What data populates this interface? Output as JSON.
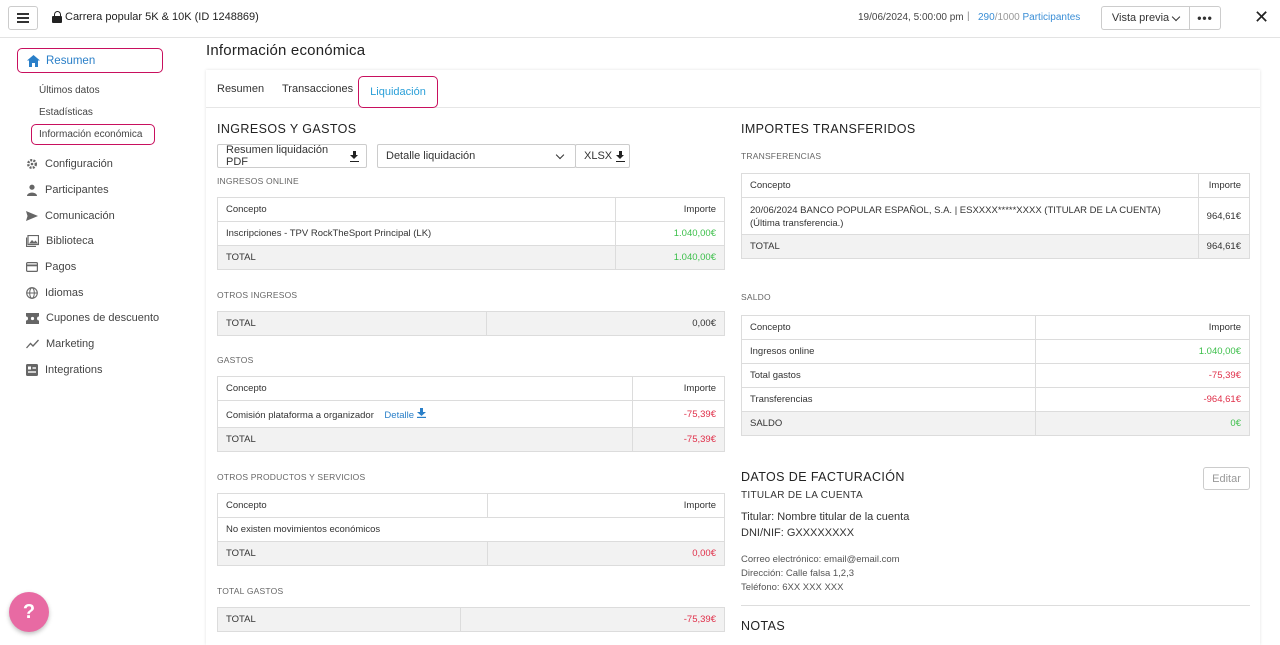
{
  "topbar": {
    "event_title": "Carrera popular 5K & 10K (ID 1248869)",
    "date": "19/06/2024, 5:00:00 pm",
    "separator": "|",
    "participants_count": "290",
    "participants_total": "/1000",
    "participants_label": " Participantes",
    "preview_label": "Vista previa",
    "more_label": "•••",
    "close_label": "✕"
  },
  "sidebar": {
    "resumen": "Resumen",
    "sub_items": [
      "Últimos datos",
      "Estadísticas",
      "Información económica"
    ],
    "items": [
      {
        "label": "Configuración",
        "icon": "gear-icon"
      },
      {
        "label": "Participantes",
        "icon": "person-icon"
      },
      {
        "label": "Comunicación",
        "icon": "send-icon"
      },
      {
        "label": "Biblioteca",
        "icon": "image-library-icon"
      },
      {
        "label": "Pagos",
        "icon": "credit-card-icon"
      },
      {
        "label": "Idiomas",
        "icon": "globe-icon"
      },
      {
        "label": "Cupones de descuento",
        "icon": "coupon-icon"
      },
      {
        "label": "Marketing",
        "icon": "trend-icon"
      },
      {
        "label": "Integrations",
        "icon": "integrations-icon"
      }
    ],
    "help": "?"
  },
  "page": {
    "title": "Información económica",
    "tabs": [
      "Resumen",
      "Transacciones",
      "Liquidación"
    ]
  },
  "left": {
    "title": "INGRESOS Y GASTOS",
    "pdf_button": "Resumen liquidación PDF",
    "detail_select": "Detalle liquidación",
    "xlsx_button": "XLSX",
    "ingresos_online": {
      "title": "INGRESOS ONLINE",
      "col_concept": "Concepto",
      "col_amount": "Importe",
      "rows": [
        {
          "concept": "Inscripciones - TPV RockTheSport Principal (LK)",
          "amount": "1.040,00€"
        }
      ],
      "total_label": "TOTAL",
      "total": "1.040,00€"
    },
    "otros_ingresos": {
      "title": "OTROS INGRESOS",
      "total_label": "TOTAL",
      "total": "0,00€"
    },
    "gastos": {
      "title": "GASTOS",
      "col_concept": "Concepto",
      "col_amount": "Importe",
      "rows": [
        {
          "concept": "Comisión plataforma a organizador",
          "link": "Detalle",
          "amount": "-75,39€"
        }
      ],
      "total_label": "TOTAL",
      "total": "-75,39€"
    },
    "otros_productos": {
      "title": "OTROS PRODUCTOS Y SERVICIOS",
      "col_concept": "Concepto",
      "col_amount": "Importe",
      "empty": "No existen movimientos económicos",
      "total_label": "TOTAL",
      "total": "0,00€"
    },
    "total_gastos": {
      "title": "TOTAL GASTOS",
      "total_label": "TOTAL",
      "total": "-75,39€"
    }
  },
  "right": {
    "title": "IMPORTES TRANSFERIDOS",
    "transferencias": {
      "title": "TRANSFERENCIAS",
      "col_concept": "Concepto",
      "col_amount": "Importe",
      "rows": [
        {
          "concept": "20/06/2024 BANCO POPULAR ESPAÑOL, S.A. | ESXXXX*****XXXX (TITULAR DE LA CUENTA) (Última transferencia.)",
          "amount": "964,61€"
        }
      ],
      "total_label": "TOTAL",
      "total": "964,61€"
    },
    "saldo": {
      "title": "SALDO",
      "col_concept": "Concepto",
      "col_amount": "Importe",
      "rows": [
        {
          "concept": "Ingresos online",
          "amount": "1.040,00€"
        },
        {
          "concept": "Total gastos",
          "amount": "-75,39€"
        },
        {
          "concept": "Transferencias",
          "amount": "-964,61€"
        }
      ],
      "total_label": "SALDO",
      "total": "0€"
    },
    "facturacion": {
      "title": "DATOS DE FACTURACIÓN",
      "edit": "Editar",
      "subtitle": "TITULAR DE LA CUENTA",
      "titular": "Titular: Nombre titular de la cuenta",
      "dni": "DNI/NIF: GXXXXXXXX",
      "email": "Correo electrónico: email@email.com",
      "direccion": "Dirección: Calle falsa 1,2,3",
      "telefono": "Teléfono: 6XX XXX XXX"
    },
    "notas": "NOTAS"
  }
}
